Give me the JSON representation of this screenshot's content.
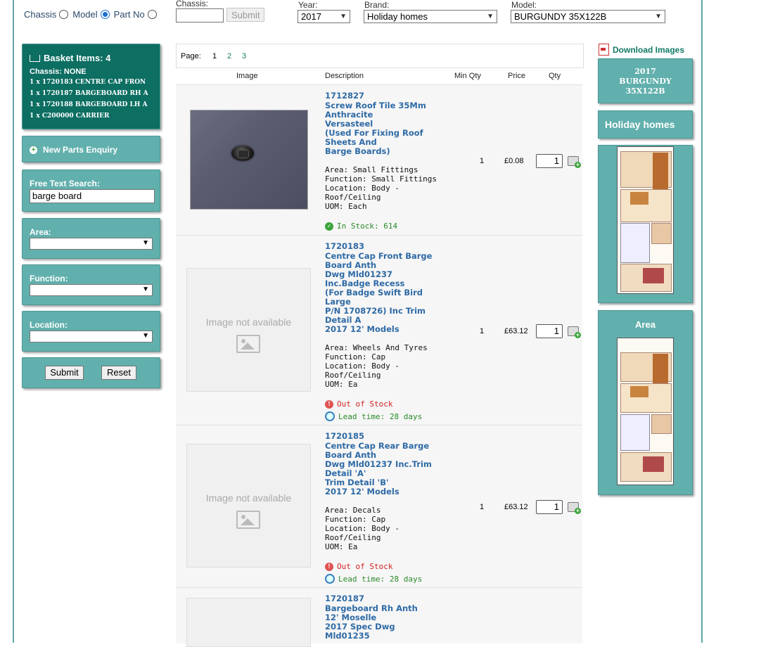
{
  "top": {
    "radio": [
      {
        "label": "Chassis",
        "checked": false
      },
      {
        "label": "Model",
        "checked": true
      },
      {
        "label": "Part No",
        "checked": false
      }
    ],
    "chassis_label": "Chassis:",
    "chassis_value": "",
    "submit_label": "Submit",
    "year_label": "Year:",
    "year_value": "2017",
    "brand_label": "Brand:",
    "brand_value": "Holiday homes",
    "model_label": "Model:",
    "model_value": "BURGUNDY 35X122B"
  },
  "basket": {
    "title": "Basket Items: 4",
    "chassis": "Chassis: NONE",
    "items": [
      "1 x 1720183 CENTRE CAP FRON",
      "1 x 1720187 BARGEBOARD RH A",
      "1 x 1720188 BARGEBOARD LH A",
      "1 x C200000 CARRIER"
    ]
  },
  "sidebar": {
    "enquiry_label": "New Parts Enquiry",
    "search_label": "Free Text Search:",
    "search_value": "barge board",
    "area_label": "Area:",
    "function_label": "Function:",
    "location_label": "Location:",
    "submit_label": "Submit",
    "reset_label": "Reset"
  },
  "pager": {
    "label": "Page:",
    "pages": [
      "1",
      "2",
      "3"
    ],
    "current": "1"
  },
  "table": {
    "headers": {
      "image": "Image",
      "description": "Description",
      "min_qty": "Min Qty",
      "price": "Price",
      "qty": "Qty"
    },
    "no_image_text": "Image not available",
    "rows": [
      {
        "code": "1712827",
        "title": "Screw Roof Tile 35Mm\nAnthracite\nVersasteel\n(Used For Fixing Roof\nSheets And\nBarge Boards)",
        "meta": "Area: Small Fittings\nFunction: Small Fittings\nLocation: Body -\nRoof/Ceiling\nUOM: Each",
        "stock": "In Stock: 614",
        "lead": "",
        "min_qty": "1",
        "price": "£0.08",
        "qty": "1"
      },
      {
        "code": "1720183",
        "title": "Centre Cap Front Barge\nBoard Anth\nDwg Mld01237\nInc.Badge Recess\n(For Badge Swift Bird\nLarge\nP/N 1708726) Inc Trim\nDetail A\n2017 12' Models",
        "meta": "Area: Wheels And Tyres\nFunction: Cap\nLocation: Body -\nRoof/Ceiling\nUOM: Ea",
        "stock": "Out of Stock",
        "lead": "Lead time: 28 days",
        "min_qty": "1",
        "price": "£63.12",
        "qty": "1"
      },
      {
        "code": "1720185",
        "title": "Centre Cap Rear Barge\nBoard Anth\nDwg Mld01237 Inc.Trim\nDetail 'A'\nTrim Detail 'B'\n2017 12' Models",
        "meta": "Area: Decals\nFunction: Cap\nLocation: Body -\nRoof/Ceiling\nUOM: Ea",
        "stock": "Out of Stock",
        "lead": "Lead time: 28 days",
        "min_qty": "1",
        "price": "£63.12",
        "qty": "1"
      },
      {
        "code": "1720187",
        "title": "Bargeboard Rh Anth\n12' Moselle\n2017 Spec Dwg\nMld01235"
      }
    ]
  },
  "right": {
    "download_label": "Download Images",
    "model_title": "2017\nBURGUNDY\n35X122B",
    "brand_title": "Holiday homes",
    "area_title": "Area"
  },
  "colors": {
    "teal": "#62b0ad",
    "dark_teal": "#0d6e62",
    "link": "#2e6aa5",
    "in_stock": "#2a8a2a",
    "out_stock": "#d42020"
  }
}
